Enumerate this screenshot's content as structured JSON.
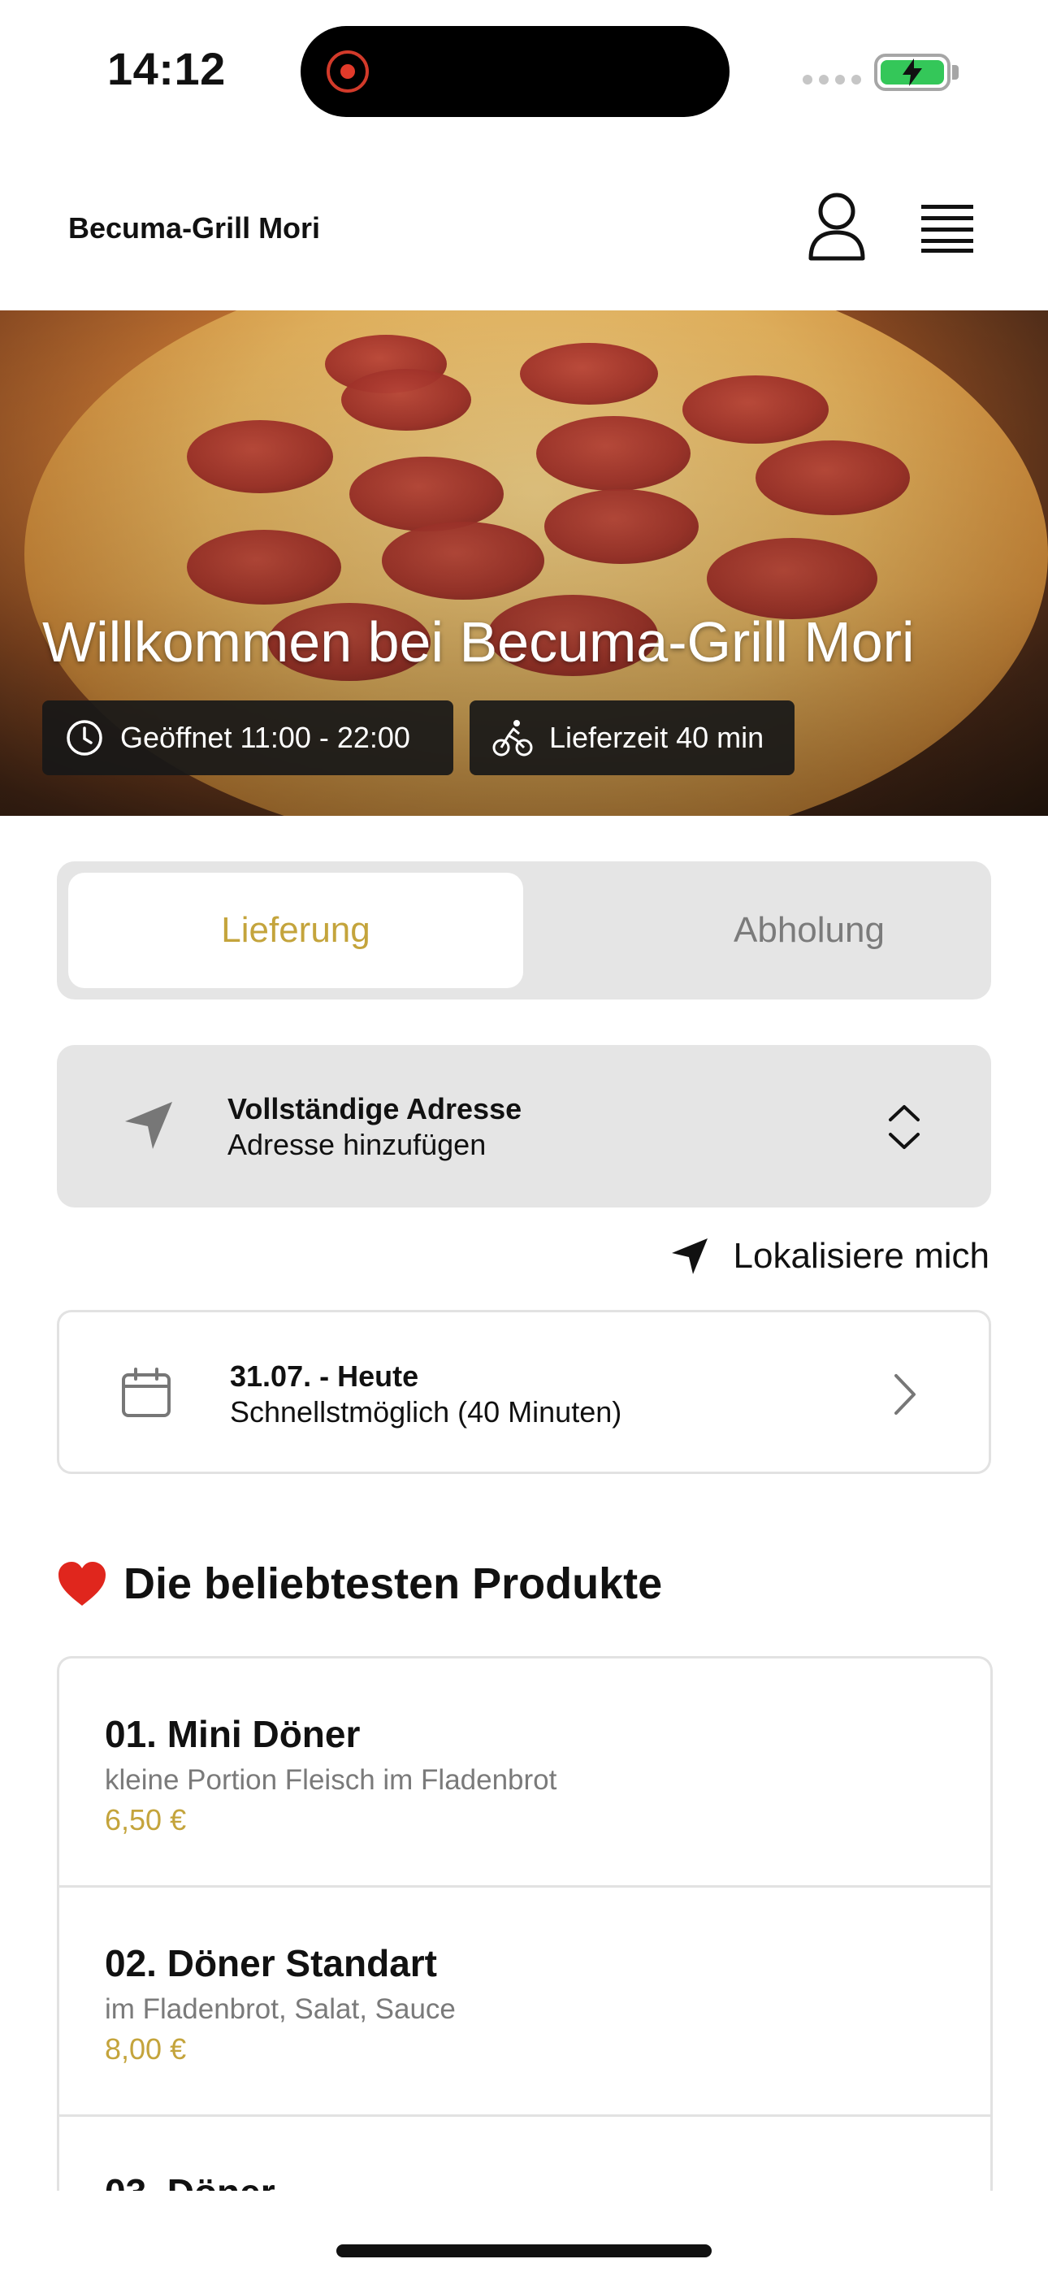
{
  "status_bar": {
    "time": "14:12"
  },
  "header": {
    "brand": "Becuma-Grill Mori"
  },
  "hero": {
    "title": "Willkommen bei Becuma-Grill Mori",
    "opening_hours": "Geöffnet 11:00 - 22:00",
    "delivery_time": "Lieferzeit 40 min"
  },
  "order_type": {
    "delivery_label": "Lieferung",
    "pickup_label": "Abholung",
    "selected": "Lieferung"
  },
  "address": {
    "title": "Vollständige Adresse",
    "subtitle": "Adresse hinzufügen"
  },
  "locate": {
    "label": "Lokalisiere mich"
  },
  "schedule": {
    "date": "31.07. - Heute",
    "time": "Schnellstmöglich (40 Minuten)"
  },
  "popular": {
    "title": "Die beliebtesten Produkte",
    "items": [
      {
        "name": "01. Mini Döner",
        "description": "kleine Portion Fleisch im Fladenbrot",
        "price": "6,50 €"
      },
      {
        "name": "02. Döner Standart",
        "description": "im Fladenbrot, Salat, Sauce",
        "price": "8,00 €"
      },
      {
        "name": "03. Döner",
        "description": "",
        "price": ""
      }
    ]
  },
  "colors": {
    "accent": "#c4a43c",
    "card_bg": "#e5e5e5",
    "battery": "#34c759",
    "heart": "#e0261d"
  },
  "icons": [
    "user-icon",
    "menu-icon",
    "clock-icon",
    "bike-icon",
    "navigation-arrow-icon",
    "updown-chevron-icon",
    "calendar-icon",
    "chevron-right-icon",
    "heart-icon"
  ]
}
